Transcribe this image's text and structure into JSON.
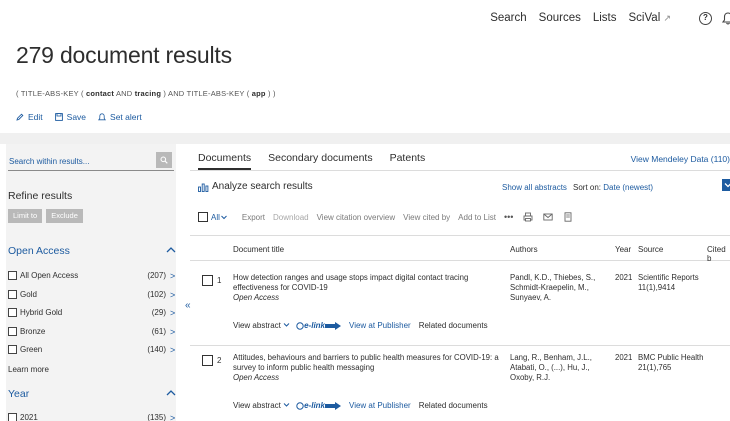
{
  "topnav": {
    "items": [
      "Search",
      "Sources",
      "Lists",
      "SciVal"
    ],
    "scival_ext": "↗"
  },
  "page": {
    "title": "279 document results",
    "query_prefix": "( TITLE-ABS-KEY (",
    "query_t1": "contact",
    "query_and1": "AND",
    "query_t2": "tracing",
    "query_mid": ") AND  TITLE-ABS-KEY (",
    "query_t3": "app",
    "query_suffix": ") )"
  },
  "actions": {
    "edit": "Edit",
    "save": "Save",
    "set_alert": "Set alert"
  },
  "sidebar": {
    "search_placeholder": "Search within results...",
    "refine_title": "Refine results",
    "limit_to": "Limit to",
    "exclude": "Exclude",
    "open_access_title": "Open Access",
    "open_access_items": [
      {
        "label": "All Open Access",
        "count": "(207)"
      },
      {
        "label": "Gold",
        "count": "(102)"
      },
      {
        "label": "Hybrid Gold",
        "count": "(29)"
      },
      {
        "label": "Bronze",
        "count": "(61)"
      },
      {
        "label": "Green",
        "count": "(140)"
      }
    ],
    "learn_more": "Learn more",
    "year_title": "Year",
    "year_items": [
      {
        "label": "2021",
        "count": "(135)"
      }
    ]
  },
  "main": {
    "tabs": [
      "Documents",
      "Secondary documents",
      "Patents"
    ],
    "mendeley": "View Mendeley Data (110)",
    "analyze": "Analyze search results",
    "show_abstracts": "Show all abstracts",
    "sort_on_label": "Sort on:",
    "sort_value": "Date (newest)",
    "toolbar": {
      "all": "All",
      "export": "Export",
      "download": "Download",
      "view_citation": "View citation overview",
      "view_cited_by": "View cited by",
      "add_to_list": "Add to List",
      "more": "•••"
    },
    "columns": {
      "title": "Document title",
      "authors": "Authors",
      "year": "Year",
      "source": "Source",
      "cited_by": "Cited b"
    },
    "results": [
      {
        "num": "1",
        "title": "How detection ranges and usage stops impact digital contact tracing effectiveness for COVID-19",
        "access": "Open Access",
        "authors": "Pandl, K.D., Thiebes, S., Schmidt-Kraepelin, M., Sunyaev, A.",
        "year": "2021",
        "source": "Scientific Reports 11(1),9414"
      },
      {
        "num": "2",
        "title": "Attitudes, behaviours and barriers to public health measures for COVID-19: a survey to inform public health messaging",
        "access": "Open Access",
        "authors": "Lang, R., Benham, J.L., Atabati, O., (...), Hu, J., Oxoby, R.J.",
        "year": "2021",
        "source": "BMC Public Health 21(1),765"
      }
    ],
    "links": {
      "view_abstract": "View abstract",
      "elink": "e-link",
      "view_at_publisher": "View at Publisher",
      "related_documents": "Related documents"
    }
  },
  "colors": {
    "link": "#1d5ba0",
    "text": "#2e2e2e",
    "panel": "#f3f3f3"
  }
}
